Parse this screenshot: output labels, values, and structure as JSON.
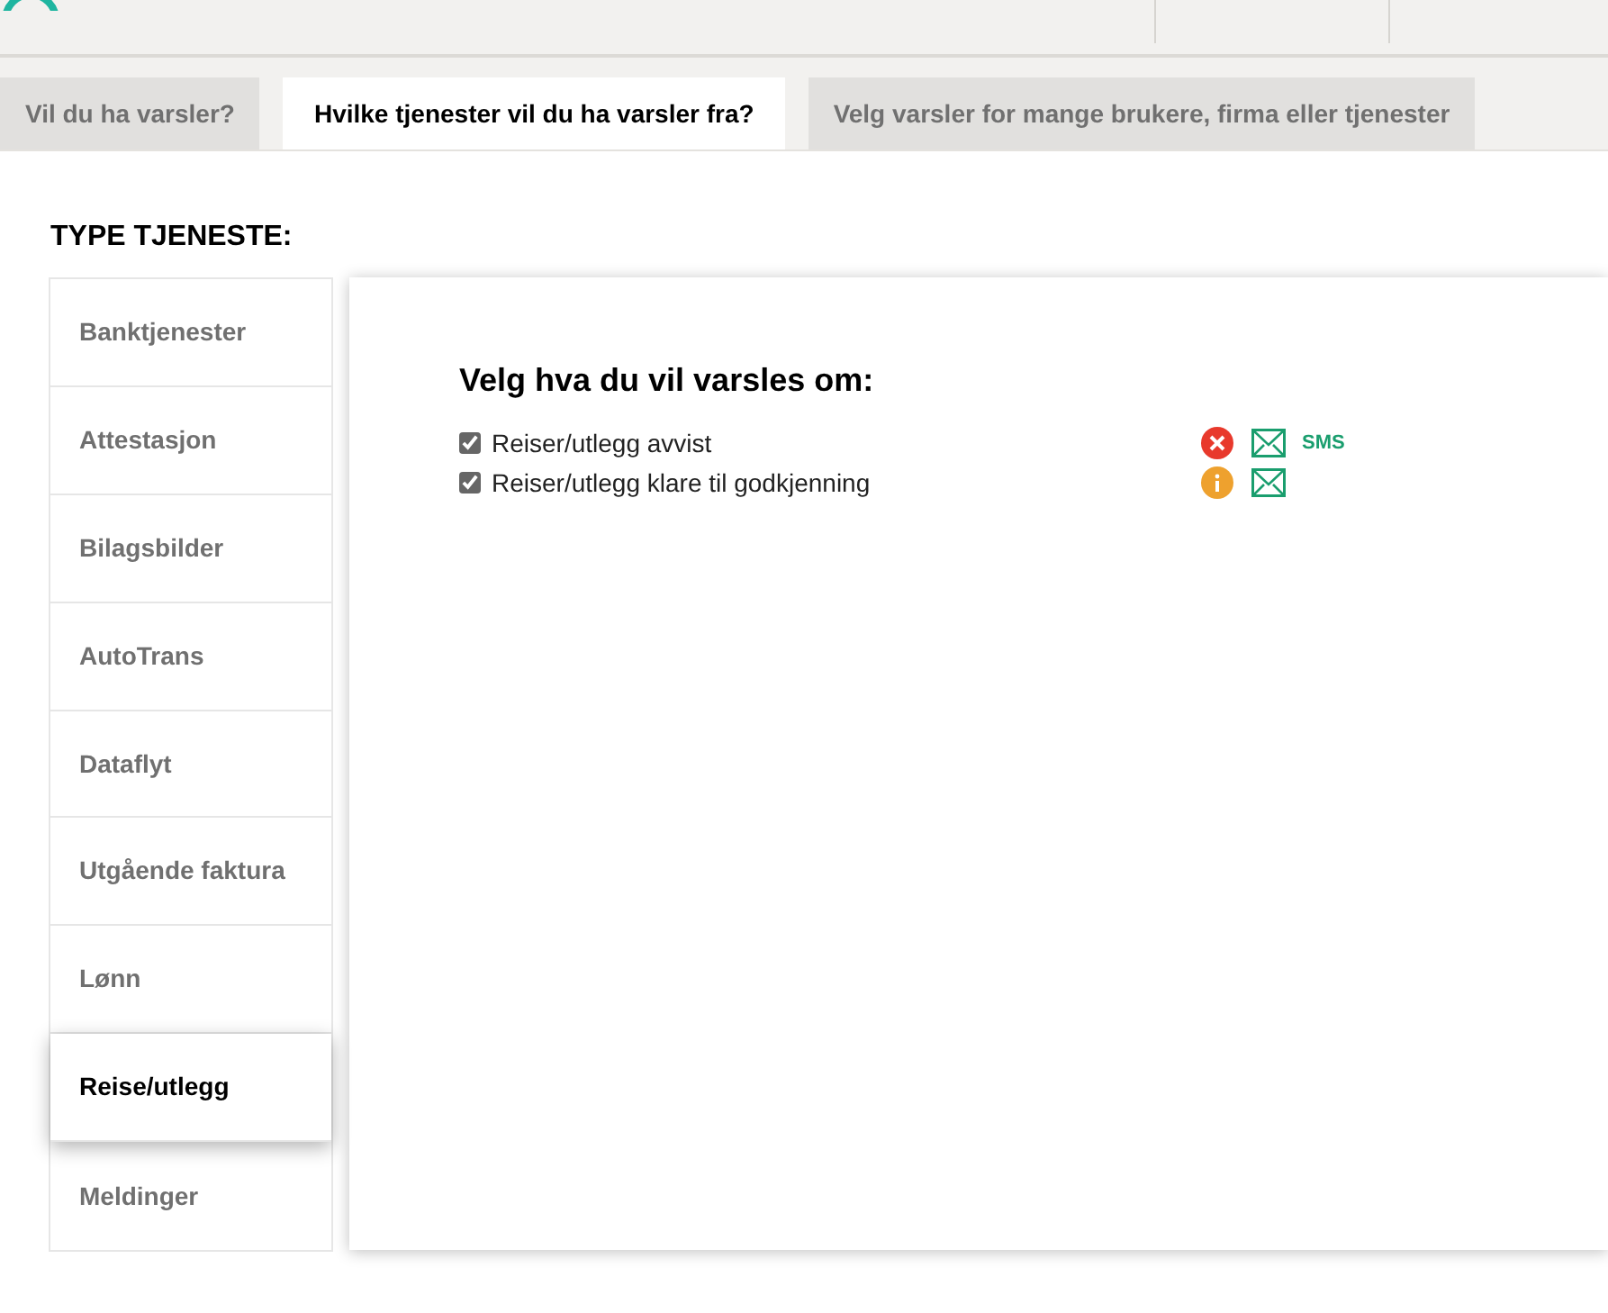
{
  "tabs": [
    {
      "label": "Vil du ha varsler?",
      "selected": false
    },
    {
      "label": "Hvilke tjenester vil du ha varsler fra?",
      "selected": true
    },
    {
      "label": "Velg varsler for mange brukere, firma eller tjenester",
      "selected": false
    }
  ],
  "sidebar": {
    "title": "TYPE TJENESTE:",
    "items": [
      {
        "label": "Banktjenester",
        "selected": false
      },
      {
        "label": "Attestasjon",
        "selected": false
      },
      {
        "label": "Bilagsbilder",
        "selected": false
      },
      {
        "label": "AutoTrans",
        "selected": false
      },
      {
        "label": "Dataflyt",
        "selected": false
      },
      {
        "label": "Utgående faktura",
        "selected": false
      },
      {
        "label": "Lønn",
        "selected": false
      },
      {
        "label": "Reise/utlegg",
        "selected": true
      },
      {
        "label": "Meldinger",
        "selected": false
      }
    ]
  },
  "panel": {
    "title": "Velg hva du vil varsles om:",
    "alerts": [
      {
        "label": "Reiser/utlegg avvist",
        "checked": true,
        "kind": "error",
        "email": true,
        "sms": "SMS"
      },
      {
        "label": "Reiser/utlegg klare til godkjenning",
        "checked": true,
        "kind": "info",
        "email": true
      }
    ]
  }
}
